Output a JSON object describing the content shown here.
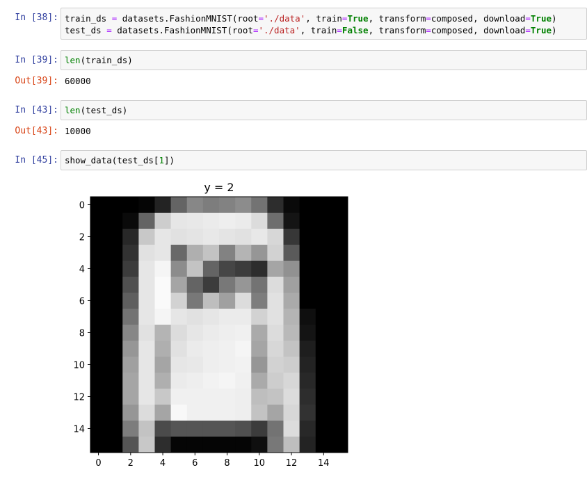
{
  "cells": [
    {
      "prompt": "In [38]:",
      "lines": [
        [
          [
            "train_ds",
            "var"
          ],
          [
            " ",
            ""
          ],
          [
            "=",
            "op"
          ],
          [
            " datasets.FashionMNIST(root",
            ""
          ],
          [
            "=",
            "op"
          ],
          [
            "'./data'",
            "str"
          ],
          [
            ", train",
            ""
          ],
          [
            "=",
            "op"
          ],
          [
            "True",
            "kw"
          ],
          [
            ", transform",
            ""
          ],
          [
            "=",
            "op"
          ],
          [
            "composed, download",
            ""
          ],
          [
            "=",
            "op"
          ],
          [
            "True",
            "kw"
          ],
          [
            ")",
            ""
          ]
        ],
        [
          [
            "test_ds",
            "var"
          ],
          [
            " ",
            ""
          ],
          [
            "=",
            "op"
          ],
          [
            " datasets.FashionMNIST(root",
            ""
          ],
          [
            "=",
            "op"
          ],
          [
            "'./data'",
            "str"
          ],
          [
            ", train",
            ""
          ],
          [
            "=",
            "op"
          ],
          [
            "False",
            "kw"
          ],
          [
            ", transform",
            ""
          ],
          [
            "=",
            "op"
          ],
          [
            "composed, download",
            ""
          ],
          [
            "=",
            "op"
          ],
          [
            "True",
            "kw"
          ],
          [
            ")",
            ""
          ]
        ]
      ]
    },
    {
      "prompt": "In [39]:",
      "lines": [
        [
          [
            "len",
            "builtin"
          ],
          [
            "(train_ds)",
            ""
          ]
        ]
      ],
      "out_prompt": "Out[39]:",
      "output": "60000"
    },
    {
      "prompt": "In [43]:",
      "lines": [
        [
          [
            "len",
            "builtin"
          ],
          [
            "(test_ds)",
            ""
          ]
        ]
      ],
      "out_prompt": "Out[43]:",
      "output": "10000"
    },
    {
      "prompt": "In [45]:",
      "lines": [
        [
          [
            "show_data(test_ds[",
            ""
          ],
          [
            "1",
            "num"
          ],
          [
            "])",
            ""
          ]
        ]
      ]
    }
  ],
  "chart_data": {
    "type": "heatmap",
    "title": "y = 2",
    "colormap": "gray",
    "x_ticks": [
      0,
      2,
      4,
      6,
      8,
      10,
      12,
      14
    ],
    "y_ticks": [
      0,
      2,
      4,
      6,
      8,
      10,
      12,
      14
    ],
    "values": [
      [
        0,
        0,
        0,
        5,
        35,
        100,
        135,
        125,
        130,
        140,
        115,
        45,
        10,
        0,
        0,
        0
      ],
      [
        0,
        0,
        10,
        100,
        205,
        230,
        232,
        235,
        238,
        235,
        220,
        110,
        20,
        0,
        0,
        0
      ],
      [
        0,
        0,
        40,
        200,
        230,
        225,
        228,
        232,
        228,
        225,
        232,
        215,
        55,
        0,
        0,
        0
      ],
      [
        0,
        0,
        50,
        225,
        230,
        105,
        175,
        195,
        130,
        180,
        150,
        210,
        90,
        0,
        0,
        0
      ],
      [
        0,
        0,
        60,
        230,
        245,
        140,
        195,
        100,
        70,
        60,
        45,
        165,
        145,
        0,
        0,
        0
      ],
      [
        0,
        0,
        80,
        230,
        250,
        165,
        100,
        60,
        120,
        150,
        115,
        220,
        160,
        0,
        0,
        0
      ],
      [
        0,
        0,
        95,
        230,
        250,
        210,
        120,
        190,
        160,
        220,
        125,
        225,
        170,
        0,
        0,
        0
      ],
      [
        0,
        0,
        115,
        230,
        245,
        230,
        225,
        230,
        235,
        235,
        210,
        225,
        180,
        15,
        0,
        0
      ],
      [
        0,
        0,
        135,
        225,
        180,
        220,
        230,
        235,
        238,
        240,
        170,
        220,
        185,
        20,
        0,
        0
      ],
      [
        0,
        0,
        150,
        230,
        175,
        225,
        235,
        238,
        240,
        245,
        165,
        215,
        195,
        30,
        0,
        0
      ],
      [
        0,
        0,
        160,
        230,
        165,
        230,
        232,
        238,
        240,
        242,
        150,
        210,
        205,
        35,
        0,
        0
      ],
      [
        0,
        0,
        165,
        230,
        175,
        235,
        238,
        242,
        245,
        240,
        170,
        205,
        215,
        40,
        0,
        0
      ],
      [
        0,
        0,
        165,
        230,
        200,
        240,
        240,
        240,
        240,
        238,
        190,
        195,
        220,
        45,
        0,
        0
      ],
      [
        0,
        0,
        150,
        220,
        165,
        248,
        240,
        240,
        240,
        238,
        195,
        165,
        215,
        50,
        0,
        0
      ],
      [
        0,
        0,
        125,
        195,
        75,
        85,
        85,
        85,
        85,
        80,
        60,
        115,
        220,
        40,
        0,
        0
      ],
      [
        0,
        0,
        85,
        200,
        45,
        5,
        5,
        5,
        5,
        5,
        15,
        120,
        190,
        35,
        0,
        0
      ]
    ]
  }
}
